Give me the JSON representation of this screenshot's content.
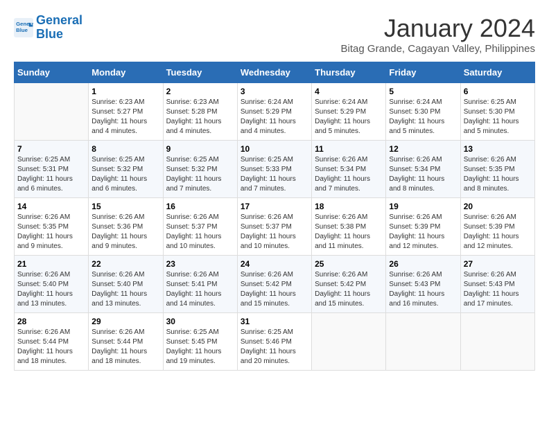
{
  "header": {
    "logo_line1": "General",
    "logo_line2": "Blue",
    "title": "January 2024",
    "subtitle": "Bitag Grande, Cagayan Valley, Philippines"
  },
  "days_of_week": [
    "Sunday",
    "Monday",
    "Tuesday",
    "Wednesday",
    "Thursday",
    "Friday",
    "Saturday"
  ],
  "weeks": [
    [
      {
        "day": "",
        "info": ""
      },
      {
        "day": "1",
        "info": "Sunrise: 6:23 AM\nSunset: 5:27 PM\nDaylight: 11 hours\nand 4 minutes."
      },
      {
        "day": "2",
        "info": "Sunrise: 6:23 AM\nSunset: 5:28 PM\nDaylight: 11 hours\nand 4 minutes."
      },
      {
        "day": "3",
        "info": "Sunrise: 6:24 AM\nSunset: 5:29 PM\nDaylight: 11 hours\nand 4 minutes."
      },
      {
        "day": "4",
        "info": "Sunrise: 6:24 AM\nSunset: 5:29 PM\nDaylight: 11 hours\nand 5 minutes."
      },
      {
        "day": "5",
        "info": "Sunrise: 6:24 AM\nSunset: 5:30 PM\nDaylight: 11 hours\nand 5 minutes."
      },
      {
        "day": "6",
        "info": "Sunrise: 6:25 AM\nSunset: 5:30 PM\nDaylight: 11 hours\nand 5 minutes."
      }
    ],
    [
      {
        "day": "7",
        "info": "Sunrise: 6:25 AM\nSunset: 5:31 PM\nDaylight: 11 hours\nand 6 minutes."
      },
      {
        "day": "8",
        "info": "Sunrise: 6:25 AM\nSunset: 5:32 PM\nDaylight: 11 hours\nand 6 minutes."
      },
      {
        "day": "9",
        "info": "Sunrise: 6:25 AM\nSunset: 5:32 PM\nDaylight: 11 hours\nand 7 minutes."
      },
      {
        "day": "10",
        "info": "Sunrise: 6:25 AM\nSunset: 5:33 PM\nDaylight: 11 hours\nand 7 minutes."
      },
      {
        "day": "11",
        "info": "Sunrise: 6:26 AM\nSunset: 5:34 PM\nDaylight: 11 hours\nand 7 minutes."
      },
      {
        "day": "12",
        "info": "Sunrise: 6:26 AM\nSunset: 5:34 PM\nDaylight: 11 hours\nand 8 minutes."
      },
      {
        "day": "13",
        "info": "Sunrise: 6:26 AM\nSunset: 5:35 PM\nDaylight: 11 hours\nand 8 minutes."
      }
    ],
    [
      {
        "day": "14",
        "info": "Sunrise: 6:26 AM\nSunset: 5:35 PM\nDaylight: 11 hours\nand 9 minutes."
      },
      {
        "day": "15",
        "info": "Sunrise: 6:26 AM\nSunset: 5:36 PM\nDaylight: 11 hours\nand 9 minutes."
      },
      {
        "day": "16",
        "info": "Sunrise: 6:26 AM\nSunset: 5:37 PM\nDaylight: 11 hours\nand 10 minutes."
      },
      {
        "day": "17",
        "info": "Sunrise: 6:26 AM\nSunset: 5:37 PM\nDaylight: 11 hours\nand 10 minutes."
      },
      {
        "day": "18",
        "info": "Sunrise: 6:26 AM\nSunset: 5:38 PM\nDaylight: 11 hours\nand 11 minutes."
      },
      {
        "day": "19",
        "info": "Sunrise: 6:26 AM\nSunset: 5:39 PM\nDaylight: 11 hours\nand 12 minutes."
      },
      {
        "day": "20",
        "info": "Sunrise: 6:26 AM\nSunset: 5:39 PM\nDaylight: 11 hours\nand 12 minutes."
      }
    ],
    [
      {
        "day": "21",
        "info": "Sunrise: 6:26 AM\nSunset: 5:40 PM\nDaylight: 11 hours\nand 13 minutes."
      },
      {
        "day": "22",
        "info": "Sunrise: 6:26 AM\nSunset: 5:40 PM\nDaylight: 11 hours\nand 13 minutes."
      },
      {
        "day": "23",
        "info": "Sunrise: 6:26 AM\nSunset: 5:41 PM\nDaylight: 11 hours\nand 14 minutes."
      },
      {
        "day": "24",
        "info": "Sunrise: 6:26 AM\nSunset: 5:42 PM\nDaylight: 11 hours\nand 15 minutes."
      },
      {
        "day": "25",
        "info": "Sunrise: 6:26 AM\nSunset: 5:42 PM\nDaylight: 11 hours\nand 15 minutes."
      },
      {
        "day": "26",
        "info": "Sunrise: 6:26 AM\nSunset: 5:43 PM\nDaylight: 11 hours\nand 16 minutes."
      },
      {
        "day": "27",
        "info": "Sunrise: 6:26 AM\nSunset: 5:43 PM\nDaylight: 11 hours\nand 17 minutes."
      }
    ],
    [
      {
        "day": "28",
        "info": "Sunrise: 6:26 AM\nSunset: 5:44 PM\nDaylight: 11 hours\nand 18 minutes."
      },
      {
        "day": "29",
        "info": "Sunrise: 6:26 AM\nSunset: 5:44 PM\nDaylight: 11 hours\nand 18 minutes."
      },
      {
        "day": "30",
        "info": "Sunrise: 6:25 AM\nSunset: 5:45 PM\nDaylight: 11 hours\nand 19 minutes."
      },
      {
        "day": "31",
        "info": "Sunrise: 6:25 AM\nSunset: 5:46 PM\nDaylight: 11 hours\nand 20 minutes."
      },
      {
        "day": "",
        "info": ""
      },
      {
        "day": "",
        "info": ""
      },
      {
        "day": "",
        "info": ""
      }
    ]
  ]
}
